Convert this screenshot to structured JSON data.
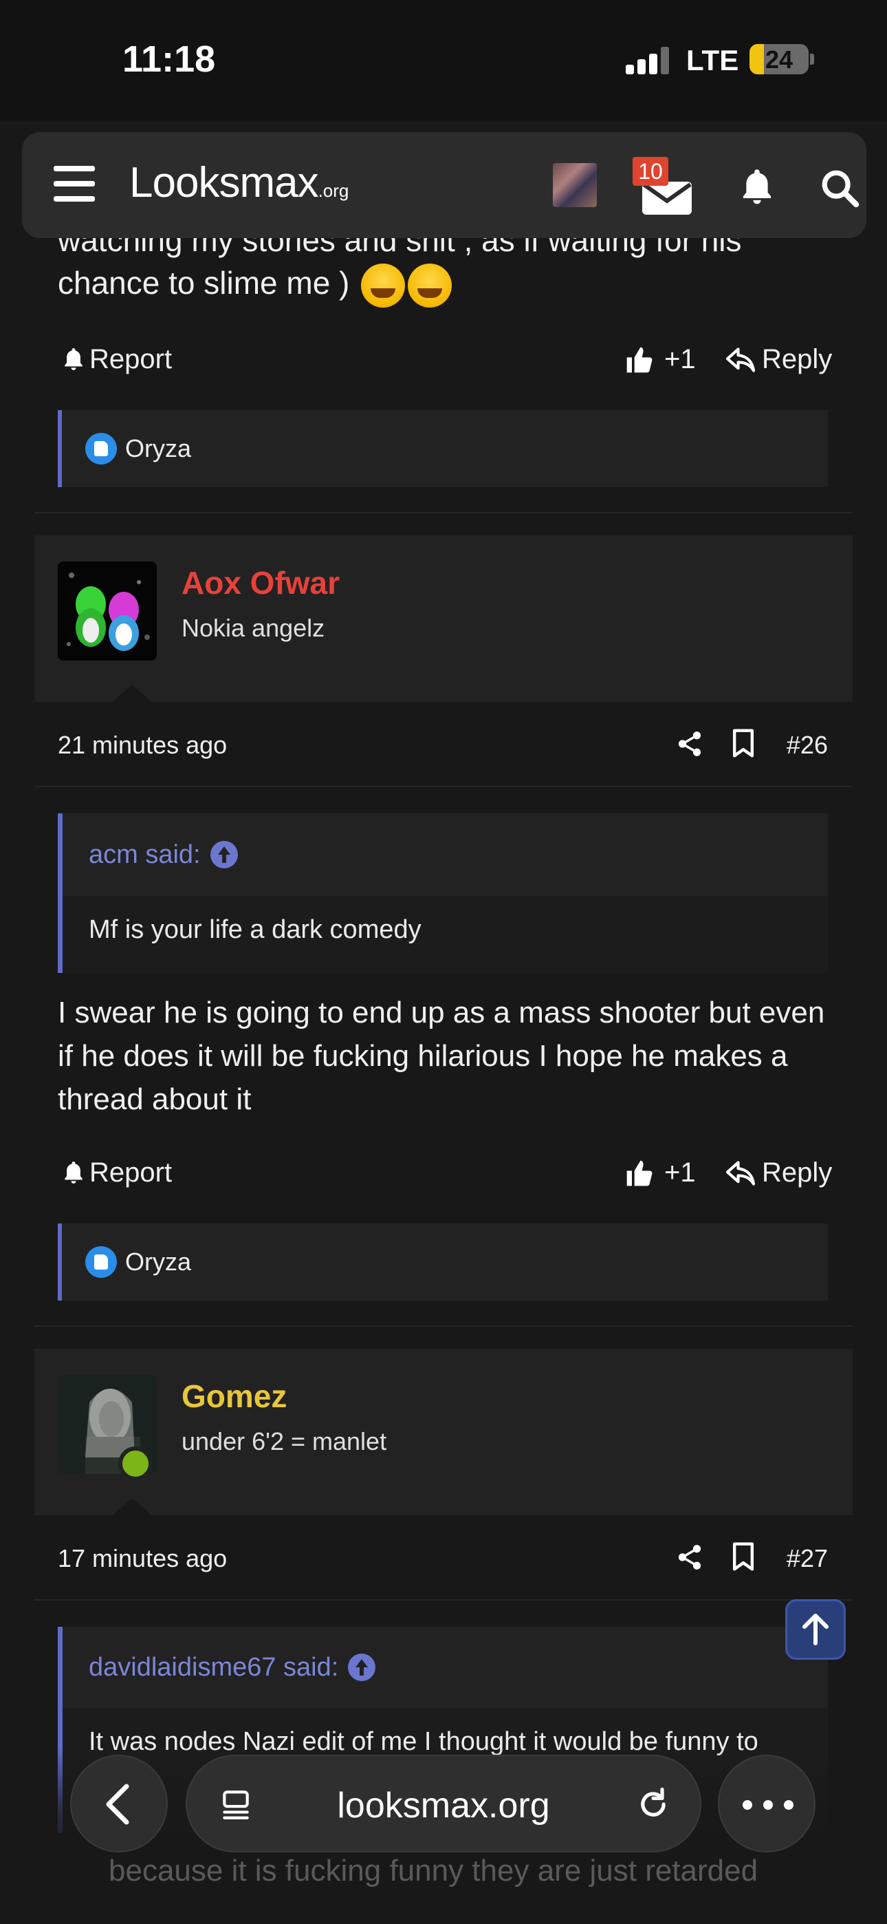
{
  "status": {
    "time": "11:18",
    "network": "LTE",
    "battery": "24",
    "battery_level": 0.24
  },
  "appbar": {
    "logo_main": "Looksmax",
    "logo_suffix": ".org",
    "inbox_badge": "10"
  },
  "prev_post": {
    "text_tail_line1": "watching my stories and shit , as if waiting for his",
    "text_tail_line2": "chance to slime me )",
    "report_label": "Report",
    "like_label": "+1",
    "reply_label": "Reply",
    "reaction_user": "Oryza"
  },
  "posts": [
    {
      "username": "Aox Ofwar",
      "user_title": "Nokia angelz",
      "name_color": "#e8413a",
      "time": "21 minutes ago",
      "number": "#26",
      "quote_author": "acm said:",
      "quote_text": "Mf is your life a dark comedy",
      "body": "I swear he is going to end up as a mass shooter but even if he does it will be fucking hilarious I hope he makes a thread about it",
      "report_label": "Report",
      "like_label": "+1",
      "reply_label": "Reply",
      "reaction_user": "Oryza"
    },
    {
      "username": "Gomez",
      "user_title": "under 6'2 = manlet",
      "name_color": "#e8c63a",
      "time": "17 minutes ago",
      "number": "#27",
      "quote_author": "davidlaidisme67 said:",
      "quote_text": "It was nodes Nazi edit of me I thought it would be funny to",
      "body_partial": "because it is fucking funny they are just retarded"
    }
  ],
  "browser": {
    "url": "looksmax.org"
  },
  "colors": {
    "accent": "#5e6bc9",
    "background": "#181818",
    "panel": "#222222"
  }
}
